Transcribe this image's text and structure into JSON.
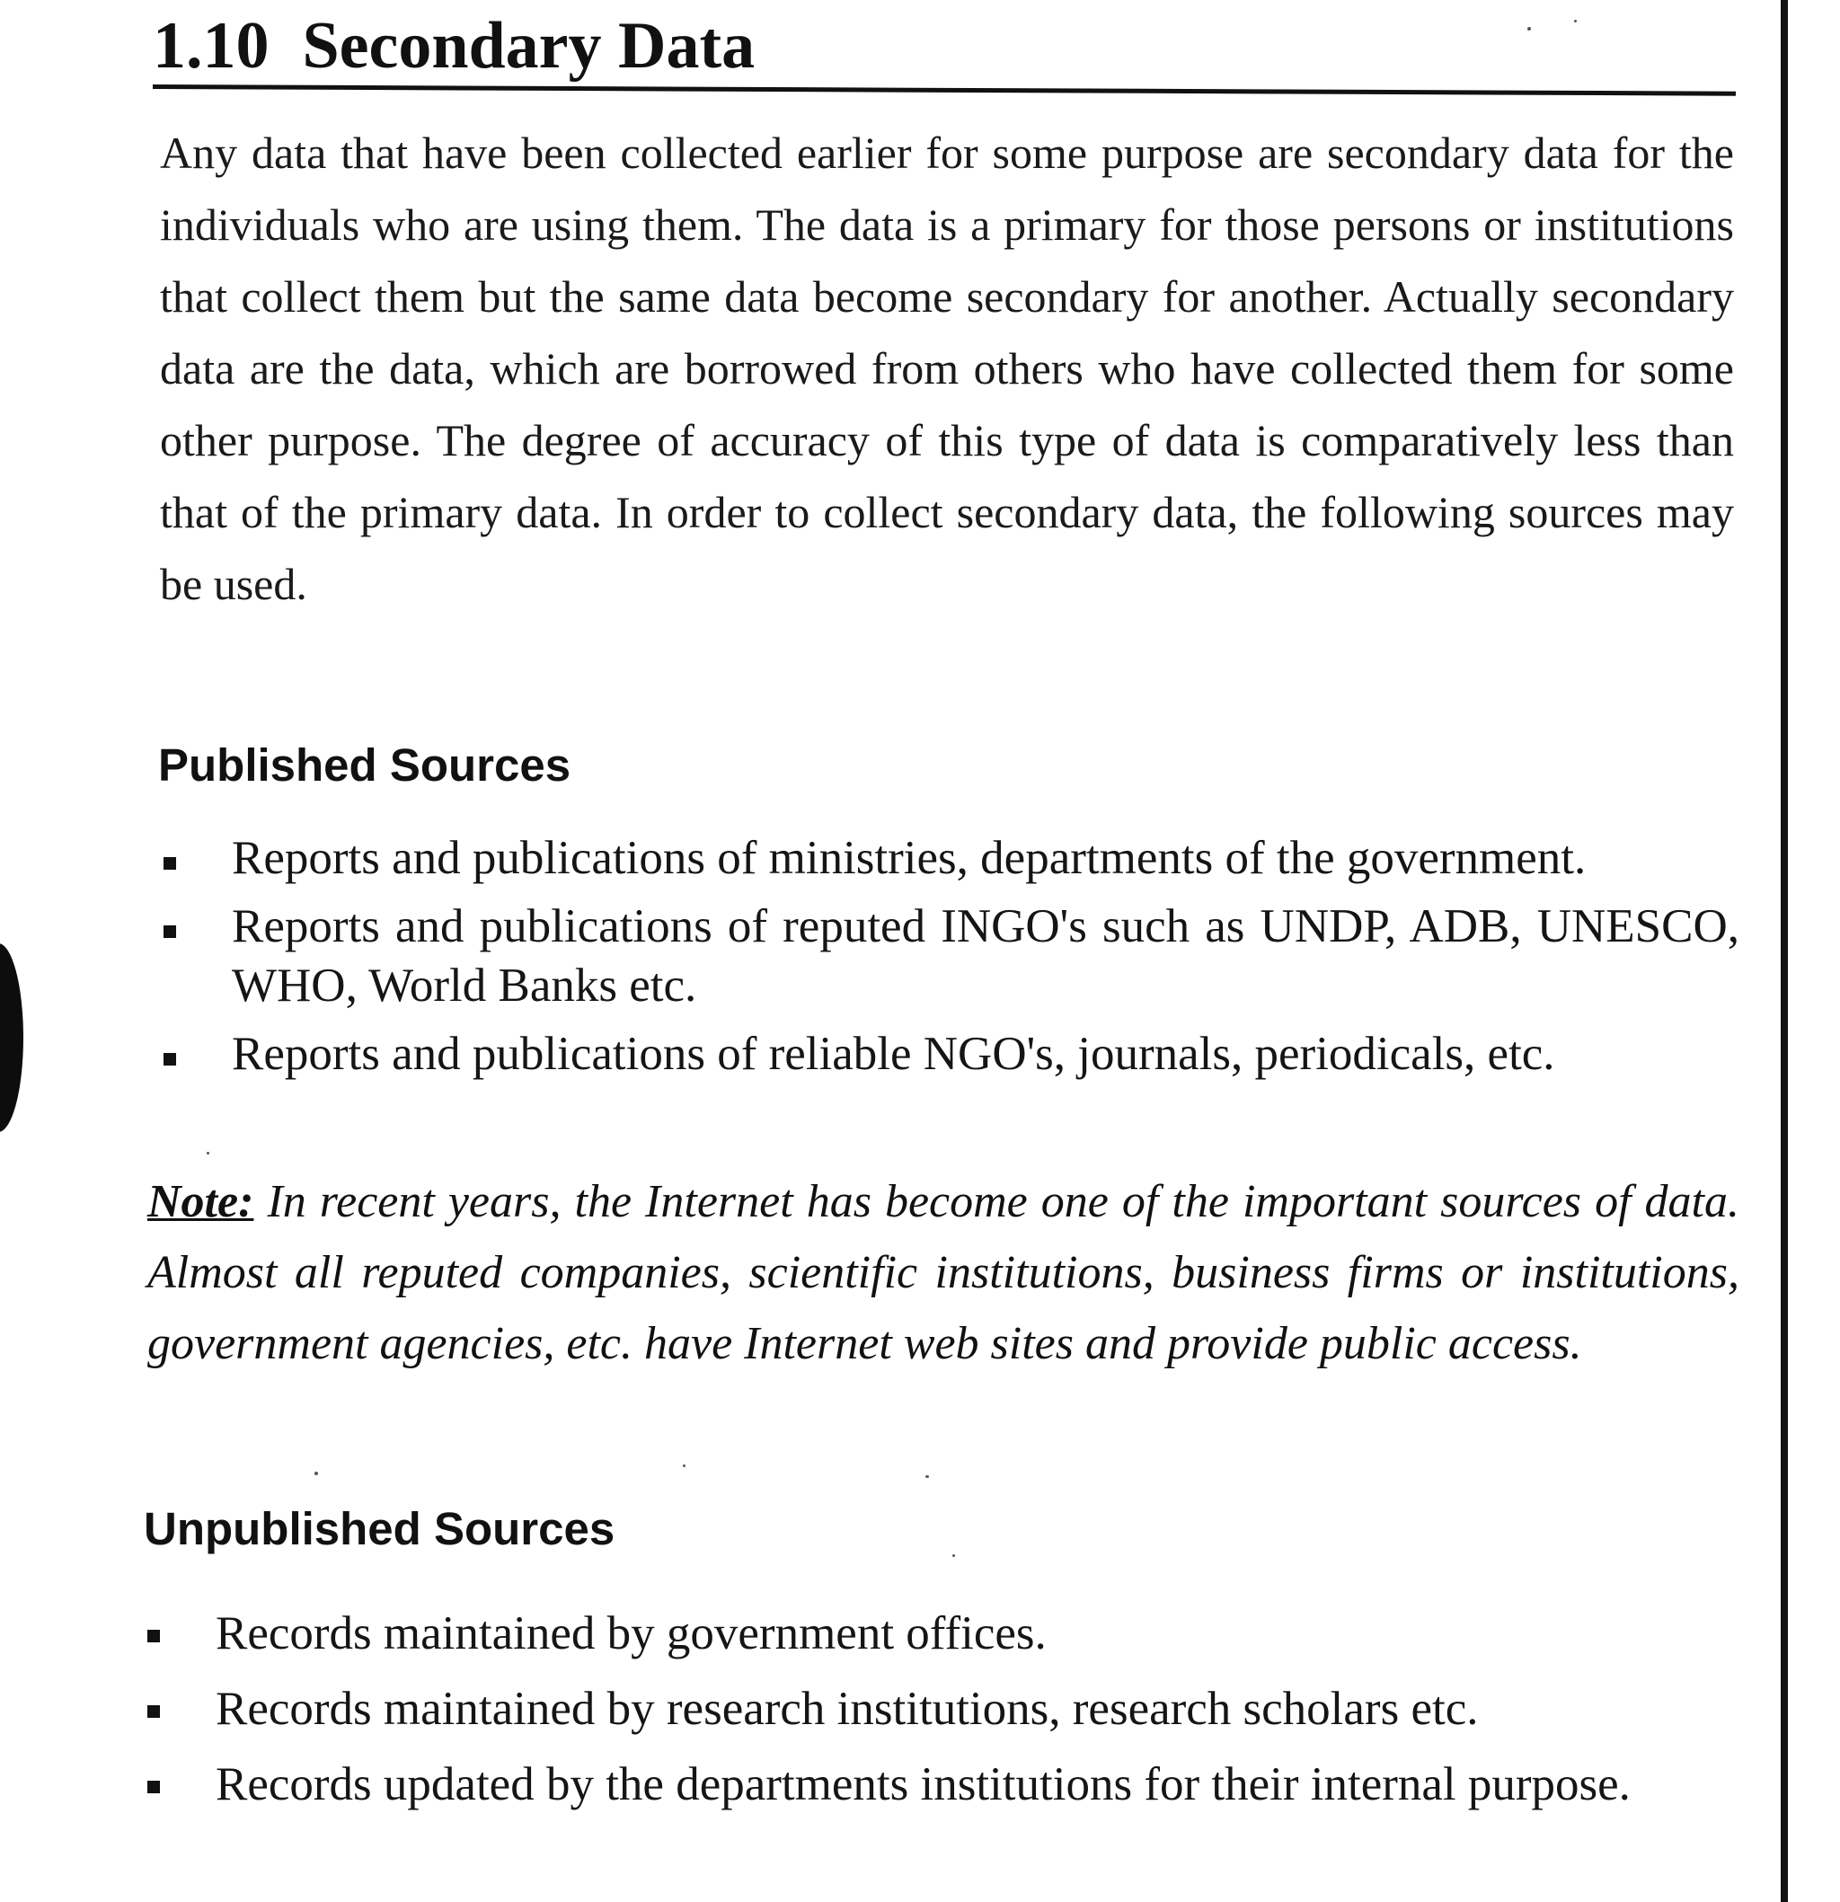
{
  "section": {
    "number": "1.10",
    "title": "Secondary Data"
  },
  "intro_paragraph": "Any data that have been collected earlier for some purpose are secondary data for the individuals who are using them. The data is a primary for those persons or institutions that collect them but the same data become secondary for another. Actually secondary data are the data, which are borrowed from others who have collected them for some other purpose. The degree of accuracy of this type of data is comparatively less than that of the primary data. In order to collect secondary data, the following sources may be used.",
  "published_sources": {
    "heading": "Published Sources",
    "items": [
      "Reports and publications of ministries, departments of the government.",
      "Reports and publications of reputed INGO's such as UNDP, ADB, UNESCO, WHO, World Banks etc.",
      "Reports and publications of reliable NGO's, journals, periodicals, etc."
    ]
  },
  "note": {
    "label": "Note:",
    "text": "In recent years, the Internet has become one of the important sources of data. Almost all reputed companies, scientific institutions, business firms or institutions, government agencies, etc. have Internet web sites and provide public access."
  },
  "unpublished_sources": {
    "heading": "Unpublished Sources",
    "items": [
      "Records maintained by government offices.",
      "Records maintained by research institutions, research scholars etc.",
      "Records updated by the departments institutions for their internal purpose."
    ]
  }
}
